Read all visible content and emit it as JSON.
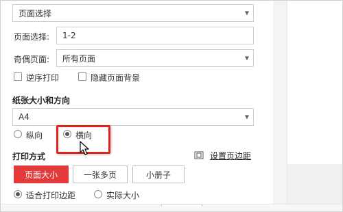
{
  "page_range": {
    "value": "页面选择"
  },
  "page_select": {
    "label": "页面选择:",
    "value": "1-2"
  },
  "odd_even": {
    "label": "奇偶页面:",
    "value": "所有页面"
  },
  "options": {
    "reverse_print": "逆序打印",
    "hide_background": "隐藏页面背景"
  },
  "paper": {
    "title": "纸张大小和方向",
    "size": "A4",
    "portrait": "纵向",
    "landscape": "横向",
    "selected_orientation": "landscape"
  },
  "print_mode": {
    "title": "打印方式",
    "margin_link": "设置页边距",
    "buttons": [
      "页面大小",
      "一张多页",
      "小册子"
    ],
    "active_button": "页面大小",
    "fit_margins": "适合打印边距",
    "actual_size": "实际大小"
  },
  "colors": {
    "accent": "#e33b3b",
    "highlight": "#e0221f"
  }
}
